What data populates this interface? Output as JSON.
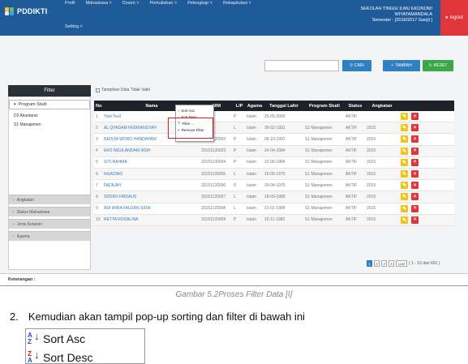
{
  "navbar": {
    "brand": "PDDIKTI",
    "menu": [
      "Profil",
      "Mahasiswa ˅",
      "Dosen ˅",
      "Perkuliahan ˅",
      "Pelengkap ˅",
      "Rekapitulasi ˅"
    ],
    "setting": "Setting ˅",
    "campus_line1": "SEKOLAH TINGGI ILMU EKONOMI",
    "campus_line2": "WIYATAMANDALA",
    "semester": "Semester : [2016/2017 Ganjil ]",
    "logout": "logout"
  },
  "toolbar": {
    "search_placeholder": "",
    "cari": "CARI",
    "tambah": "TAMBAH",
    "reset": "RESET"
  },
  "filter": {
    "title": "Filter",
    "prodi_label": "Program Studi",
    "prodi_items": [
      "D3 Akuntansi",
      "S1 Manajemen"
    ],
    "sections": [
      "Angkatan",
      "Status Mahasiswa",
      "Jenis Kelamin",
      "Agama"
    ]
  },
  "show_invalid_label": "Tampilkan Data Tidak Valid",
  "table": {
    "headers": [
      "No.",
      "Nama",
      "NIM",
      "L/P",
      "Agama",
      "Tanggal Lahir",
      "Program Studi",
      "Status",
      "Angkatan"
    ],
    "rows": [
      {
        "no": "1",
        "nama": "Yani Tes2",
        "nim": "",
        "lp": "P",
        "agama": "Islam",
        "tgl": "25-05-2000",
        "prodi": "",
        "status": "AKTIF",
        "angkatan": ""
      },
      {
        "no": "2",
        "nama": "AL QYADAM FEBRIANSYAH",
        "nim": "001",
        "lp": "L",
        "agama": "Islam",
        "tgl": "26-02-1991",
        "prodi": "S1 Manajemen",
        "status": "AKTIF",
        "angkatan": "2015"
      },
      {
        "no": "3",
        "nama": "NEISYA WORO HANDAYANI",
        "nim": "20151120002",
        "lp": "P",
        "agama": "Islam",
        "tgl": "06-10-1991",
        "prodi": "S1 Manajemen",
        "status": "AKTIF",
        "angkatan": "2015"
      },
      {
        "no": "4",
        "nama": "EKO NGULANDARI ASIH",
        "nim": "20151120003",
        "lp": "P",
        "agama": "Islam",
        "tgl": "24-04-1984",
        "prodi": "S1 Manajemen",
        "status": "AKTIF",
        "angkatan": "2015"
      },
      {
        "no": "5",
        "nama": "SITI RAHMA",
        "nim": "20151120004",
        "lp": "P",
        "agama": "Islam",
        "tgl": "22-06-1984",
        "prodi": "S1 Manajemen",
        "status": "AKTIF",
        "angkatan": "2015"
      },
      {
        "no": "6",
        "nama": "NGADINO",
        "nim": "20151120005",
        "lp": "L",
        "agama": "Islam",
        "tgl": "15-06-1975",
        "prodi": "S1 Manajemen",
        "status": "AKTIF",
        "angkatan": "2015"
      },
      {
        "no": "7",
        "nama": "FADILAH",
        "nim": "20151120006",
        "lp": "P",
        "agama": "Islam",
        "tgl": "20-04-1975",
        "prodi": "S1 Manajemen",
        "status": "AKTIF",
        "angkatan": "2015"
      },
      {
        "no": "8",
        "nama": "SIDDRI FIRDAUS",
        "nim": "20151120007",
        "lp": "L",
        "agama": "Islam",
        "tgl": "18-09-1989",
        "prodi": "S1 Manajemen",
        "status": "AKTIF",
        "angkatan": "2015"
      },
      {
        "no": "9",
        "nama": "ADI WIRA FAUZAN SIDIK",
        "nim": "20151120008",
        "lp": "L",
        "agama": "Islam",
        "tgl": "21-01-1984",
        "prodi": "S1 Manajemen",
        "status": "AKTIF",
        "angkatan": "2015"
      },
      {
        "no": "10",
        "nama": "RETTA ROSALINA",
        "nim": "20151120009",
        "lp": "P",
        "agama": "Islam",
        "tgl": "15-11-1982",
        "prodi": "S1 Manajemen",
        "status": "AKTIF",
        "angkatan": "2015"
      }
    ]
  },
  "context_menu": [
    "Sort Asc",
    "Sort Desc",
    "Filter ...",
    "Remove Filter"
  ],
  "pagination": {
    "pages": [
      "1",
      "2",
      "3",
      "4"
    ],
    "last": "Last",
    "info": "( 1 - 10 dari 601 )"
  },
  "keterangan": "Keterangan :",
  "caption": "Gambar 5.2Proses Filter Data [I]",
  "step": {
    "number": "2.",
    "text": "Kemudian akan tampil pop-up sorting dan filter di bawah ini"
  },
  "popup": {
    "sort_asc": "Sort Asc",
    "sort_desc": "Sort Desc"
  }
}
